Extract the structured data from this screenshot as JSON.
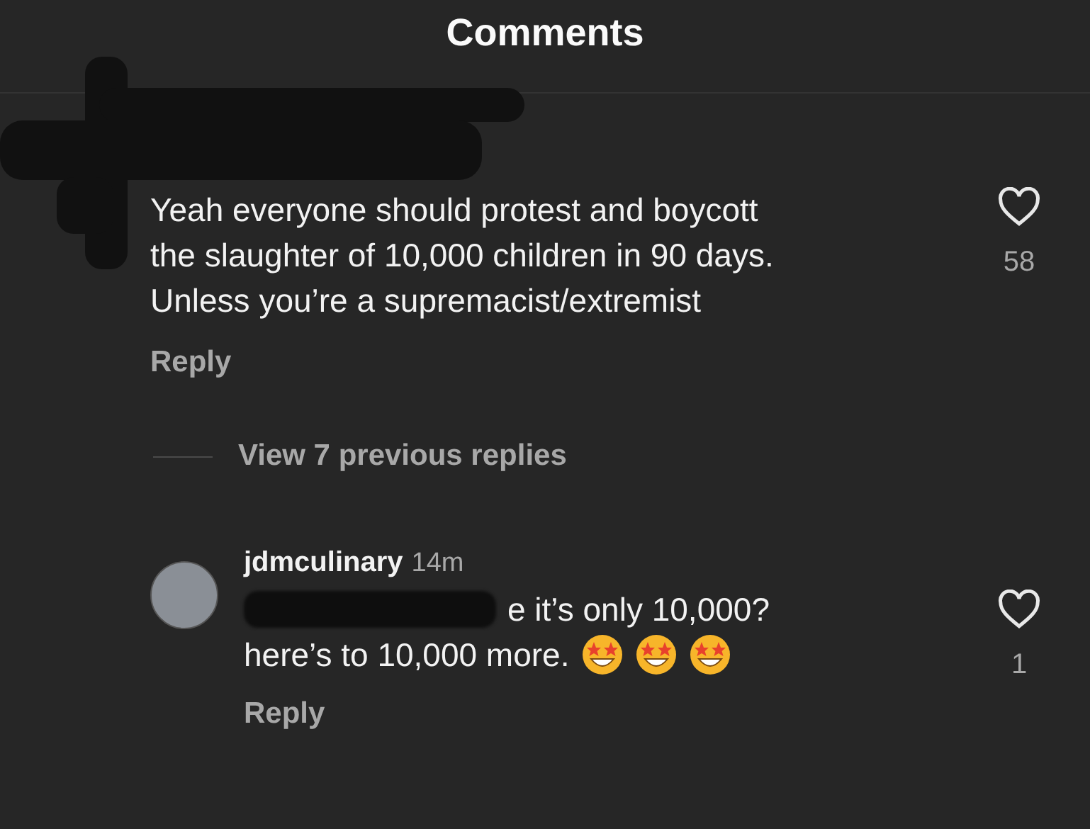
{
  "header": {
    "title": "Comments"
  },
  "comment": {
    "text_lines": [
      "Yeah everyone should protest and boycott",
      "the slaughter of 10,000 children in 90 days.",
      "Unless you’re a supremacist/extremist"
    ],
    "likes": "58",
    "liked": false,
    "reply": "Reply"
  },
  "view_replies": "View 7 previous replies",
  "reply_comment": {
    "username": "jdmculinary",
    "time": "14m",
    "text_lines": [
      "e it’s only 10,000?",
      "here’s to 10,000 more."
    ],
    "likes": "1",
    "liked": false,
    "reply": "Reply"
  }
}
